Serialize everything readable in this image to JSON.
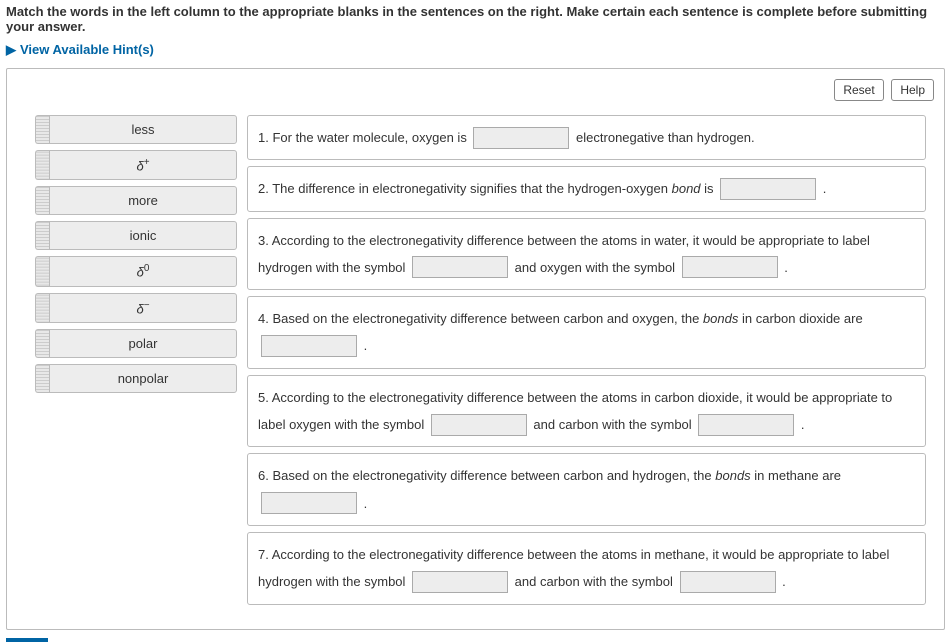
{
  "instructions": "Match the words in the left column to the appropriate blanks in the sentences on the right. Make certain each sentence is complete before submitting your answer.",
  "hints_label": "View Available Hint(s)",
  "buttons": {
    "reset": "Reset",
    "help": "Help"
  },
  "words": [
    {
      "label": "less"
    },
    {
      "label_html": "δ⁺"
    },
    {
      "label": "more"
    },
    {
      "label": "ionic"
    },
    {
      "label_html": "δ⁰"
    },
    {
      "label_html": "δ⁻"
    },
    {
      "label": "polar"
    },
    {
      "label": "nonpolar"
    }
  ],
  "sentences": {
    "s1a": "1. For the water molecule, oxygen is ",
    "s1b": " electronegative than hydrogen.",
    "s2a": "2. The difference in electronegativity signifies that the hydrogen-oxygen ",
    "s2a_ital": "bond",
    "s2a2": " is ",
    "s2b": " .",
    "s3a": "3. According to the electronegativity difference between the atoms in water, it would be appropriate to label hydrogen with the symbol ",
    "s3b": " and oxygen with the symbol ",
    "s3c": " .",
    "s4a": "4. Based on the electronegativity difference between carbon and oxygen, the ",
    "s4a_ital": "bonds",
    "s4a2": " in carbon dioxide are ",
    "s4b": " .",
    "s5a": "5. According to the electronegativity difference between the atoms in carbon dioxide, it would be appropriate to label oxygen with the symbol ",
    "s5b": " and carbon with the symbol ",
    "s5c": " .",
    "s6a": "6. Based on the electronegativity difference between carbon and hydrogen, the ",
    "s6a_ital": "bonds",
    "s6a2": " in methane are ",
    "s6b": " .",
    "s7a": "7. According to the electronegativity difference between the atoms in methane, it would be appropriate to label hydrogen with the symbol ",
    "s7b": " and carbon with the symbol ",
    "s7c": " ."
  }
}
